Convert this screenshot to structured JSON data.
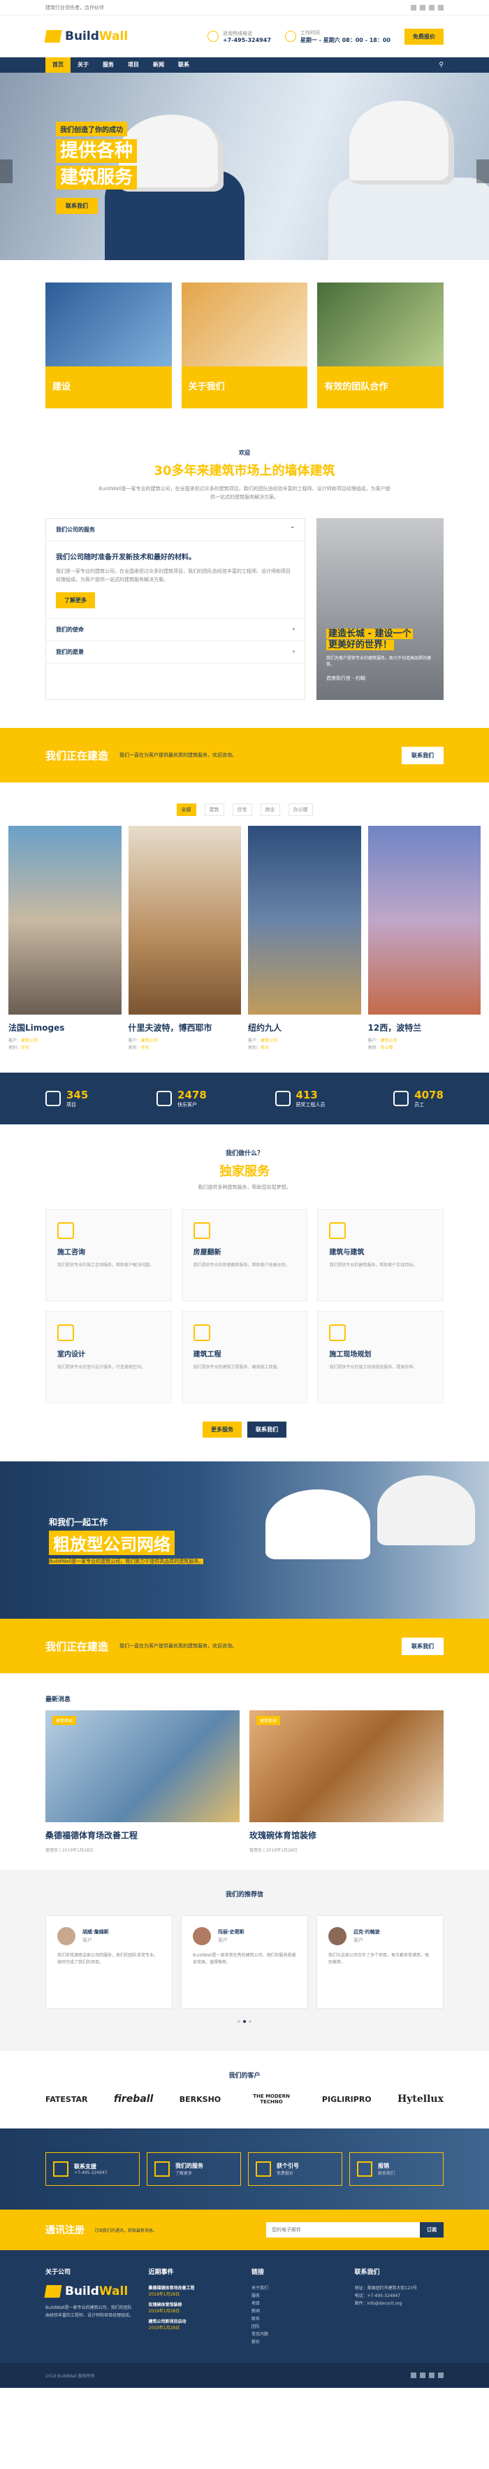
{
  "topbar": {
    "text": "建筑行业领先者，合作伙伴"
  },
  "header": {
    "logo": {
      "a": "Build",
      "b": "Wall"
    },
    "call": {
      "label": "咨询热线电话",
      "value": "+7-495-324947"
    },
    "hours": {
      "label": "工作时间",
      "value": "星期一 - 星期六 08：00 - 18：00"
    },
    "quote": "免费报价"
  },
  "nav": {
    "items": [
      "首页",
      "关于",
      "服务",
      "项目",
      "新闻",
      "联系"
    ]
  },
  "hero": {
    "small": "我们创造了你的成功",
    "big1": "提供各种",
    "big2": "建筑服务",
    "btn": "联系我们"
  },
  "cards": [
    {
      "label": "建设"
    },
    {
      "label": "关于我们"
    },
    {
      "label": "有效的团队合作"
    }
  ],
  "about": {
    "pre": "欢迎",
    "title": "30多年来建筑市场上的墙体建筑",
    "lead": "BuildWall是一家专业的建筑公司，在全国承担过众多的建筑项目，我们的团队由经验丰富的工程师、设计师和项目经理组成，为客户提供一站式的建筑服务解决方案。",
    "acc_head1": "我们公司的服务",
    "acc_title": "我们公司随时准备开发新技术和最好的材料。",
    "acc_text": "我们是一家专业的建筑公司，在全国承担过众多的建筑项目，我们的团队由经验丰富的工程师、设计师和项目经理组成，为客户提供一站式的建筑服务解决方案。",
    "acc_btn": "了解更多",
    "acc_head2": "我们的使命",
    "acc_head3": "我们的愿景",
    "promo_a": "建造长城 - 建设一个",
    "promo_b": "更美好的世界！",
    "promo_text": "我们为客户提供专业的建筑服务，致力于创造高品质的建筑。",
    "promo_sign": "首席执行官 - 约翰"
  },
  "cta1": {
    "title": "我们正在建造",
    "text": "我们一直在为客户提供最优质的建筑服务，欢迎咨询。",
    "btn": "联系我们"
  },
  "projects": {
    "filters": [
      "全部",
      "建筑",
      "住宅",
      "商业",
      "办公楼"
    ],
    "items": [
      {
        "title": "法国Limoges",
        "m1": "客户：",
        "v1": "建筑公司",
        "m2": "类别：",
        "v2": "住宅"
      },
      {
        "title": "什里夫波特，博西耶市",
        "m1": "客户：",
        "v1": "建筑公司",
        "m2": "类别：",
        "v2": "住宅"
      },
      {
        "title": "纽约九人",
        "m1": "客户：",
        "v1": "建筑公司",
        "m2": "类别：",
        "v2": "商业"
      },
      {
        "title": "12西，波特兰",
        "m1": "客户：",
        "v1": "建筑公司",
        "m2": "类别：",
        "v2": "办公楼"
      }
    ]
  },
  "stats": [
    {
      "n": "345",
      "t": "项目"
    },
    {
      "n": "2478",
      "t": "快乐客户"
    },
    {
      "n": "413",
      "t": "获奖工程人员"
    },
    {
      "n": "4078",
      "t": "员工"
    }
  ],
  "services": {
    "pre": "我们做什么？",
    "title": "独家服务",
    "lead": "我们提供多种建筑服务，帮助您实现梦想。",
    "items": [
      {
        "title": "施工咨询",
        "text": "我们提供专业的施工咨询服务，帮助客户解决问题。"
      },
      {
        "title": "房屋翻新",
        "text": "我们提供专业的房屋翻新服务，帮助客户改善住房。"
      },
      {
        "title": "建筑与建筑",
        "text": "我们提供专业的建筑服务，帮助客户实现目标。"
      },
      {
        "title": "室内设计",
        "text": "我们提供专业的室内设计服务，打造美观空间。"
      },
      {
        "title": "建筑工程",
        "text": "我们提供专业的建筑工程服务，确保施工质量。"
      },
      {
        "title": "施工现场规划",
        "text": "我们提供专业的施工现场规划服务，提高效率。"
      }
    ],
    "btn1": "更多服务",
    "btn2": "联系我们"
  },
  "banner2": {
    "small": "和我们一起工作",
    "big": "粗放型公司网络",
    "text_a": "BuildWall是一家专业的建筑公司，",
    "text_b": "我们致力于提供高品质的建筑服务。"
  },
  "cta2": {
    "title": "我们正在建造",
    "text": "我们一直在为客户提供最优质的建筑服务，欢迎咨询。",
    "btn": "联系我们"
  },
  "news": {
    "title": "最新消息",
    "items": [
      {
        "tag": "建筑新闻",
        "title": "桑德福德体育场改善工程",
        "meta": "管理员 | 2019年1月28日"
      },
      {
        "tag": "建筑新闻",
        "title": "玫瑰碗体育馆装修",
        "meta": "管理员 | 2019年1月28日"
      }
    ]
  },
  "testimonials": {
    "pre": "我们的推荐信",
    "items": [
      {
        "name": "胡威·詹姆斯",
        "role": "客户",
        "text": "我们非常满意这家公司的服务，他们的团队非常专业，按时完成了我们的项目。"
      },
      {
        "name": "玛丽·史密斯",
        "role": "客户",
        "text": "BuildWall是一家非常优秀的建筑公司，他们的服务质量非常高，值得推荐。"
      },
      {
        "name": "迈克·约翰逊",
        "role": "客户",
        "text": "我们与这家公司合作了多个项目，每次都非常满意，强烈推荐。"
      }
    ]
  },
  "partners": {
    "title": "我们的客户",
    "items": [
      "FATESTAR",
      "fireball",
      "BERKSHO",
      "THE MODERN TECHNO",
      "PIGLIRIPRO",
      "Hytellux"
    ]
  },
  "quick": [
    {
      "t": "联系支援",
      "s": "+7-495-324947"
    },
    {
      "t": "我们的服务",
      "s": "了解更多"
    },
    {
      "t": "获个引号",
      "s": "免费报价"
    },
    {
      "t": "报销",
      "s": "联系我们"
    }
  ],
  "subscribe": {
    "title": "通讯注册",
    "text": "订阅我们的通讯，获取最新消息。",
    "placeholder": "您的电子邮件",
    "btn": "订阅"
  },
  "footer": {
    "about_title": "关于公司",
    "about_text": "BuildWall是一家专业的建筑公司，我们的团队由经验丰富的工程师、设计师和项目经理组成。",
    "recent_title": "近期事件",
    "posts": [
      {
        "t": "桑德福德体育场改善工程",
        "d": "2019年1月28日"
      },
      {
        "t": "玫瑰碗体育馆装修",
        "d": "2019年1月28日"
      },
      {
        "t": "建筑公司新项目启动",
        "d": "2019年1月28日"
      }
    ],
    "links_title": "链接",
    "links": [
      "关于我们",
      "服务",
      "项目",
      "新闻",
      "联系",
      "团队",
      "常见问题",
      "报价"
    ],
    "contact_title": "联系我们",
    "contact": [
      "地址：美国纽约市建筑大街123号",
      "电话：+7-495-324947",
      "邮件：info@decorit.org"
    ]
  },
  "bottom": {
    "copy": "2019 BuildWall 版权所有"
  }
}
